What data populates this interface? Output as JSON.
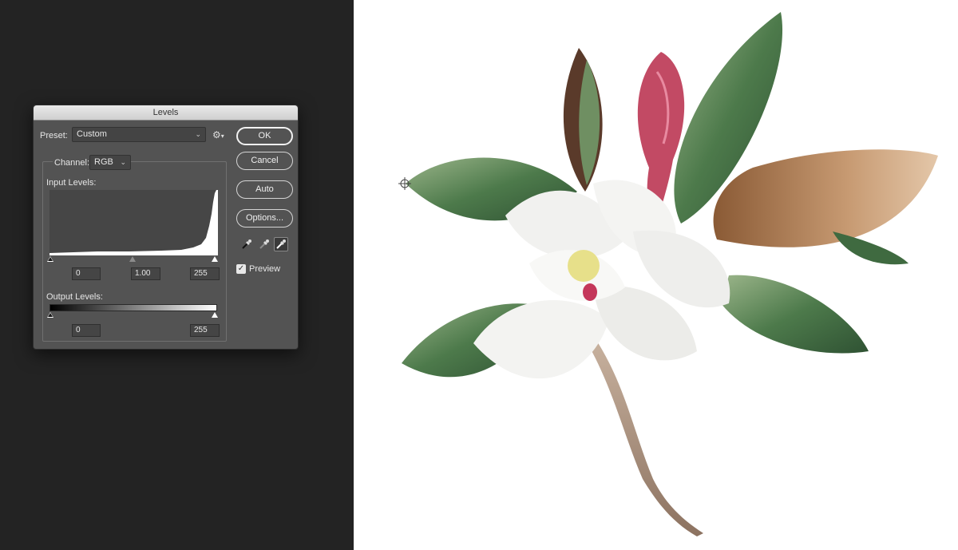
{
  "dialog": {
    "title": "Levels",
    "preset_label": "Preset:",
    "preset_value": "Custom",
    "channel_label": "Channel:",
    "channel_value": "RGB",
    "input_levels_label": "Input Levels:",
    "input_black": "0",
    "input_gamma": "1.00",
    "input_white": "255",
    "output_levels_label": "Output Levels:",
    "output_black": "0",
    "output_white": "255",
    "buttons": {
      "ok": "OK",
      "cancel": "Cancel",
      "auto": "Auto",
      "options": "Options..."
    },
    "preview_label": "Preview",
    "preview_checked": true,
    "icons": {
      "gear": "gear-icon",
      "black_eyedropper": "eyedropper-black-icon",
      "gray_eyedropper": "eyedropper-gray-icon",
      "white_eyedropper": "eyedropper-white-icon"
    }
  },
  "colors": {
    "workspace": "#232323",
    "dialog_bg": "#535353",
    "canvas_bg": "#ffffff"
  }
}
